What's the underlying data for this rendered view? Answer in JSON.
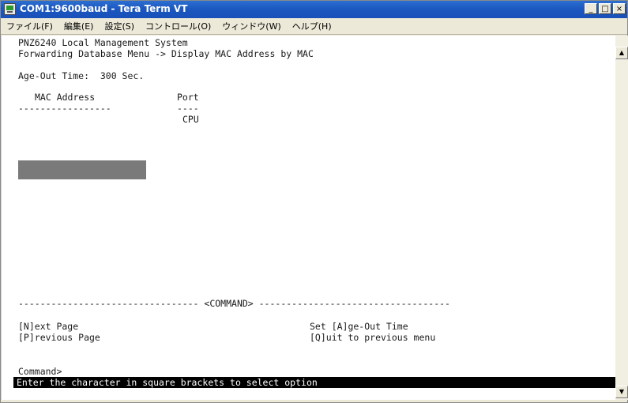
{
  "window": {
    "title": "COM1:9600baud - Tera Term VT",
    "buttons": {
      "minimize": "_",
      "maximize": "□",
      "close": "×"
    }
  },
  "menu": {
    "items": [
      "ファイル(F)",
      "編集(E)",
      "設定(S)",
      "コントロール(O)",
      "ウィンドウ(W)",
      "ヘルプ(H)"
    ]
  },
  "terminal": {
    "system_name": "PNZ6240 Local Management System",
    "breadcrumb": "Forwarding Database Menu -> Display MAC Address by MAC",
    "age_out": "Age-Out Time:  300 Sec.",
    "col_mac": "MAC Address",
    "col_port": "Port",
    "mac_rule": "-----------------",
    "port_rule": "----",
    "port_value": "CPU",
    "command_rule": "--------------------------------- <COMMAND> -----------------------------------",
    "cmd_next": "[N]ext Page",
    "cmd_prev": "[P]revious Page",
    "cmd_age": "Set [A]ge-Out Time",
    "cmd_quit": "[Q]uit to previous menu",
    "prompt": "Command>",
    "status": "Enter the character in square brackets to select option"
  },
  "scrollbar": {
    "up_arrow": "▲",
    "down_arrow": "▼"
  }
}
